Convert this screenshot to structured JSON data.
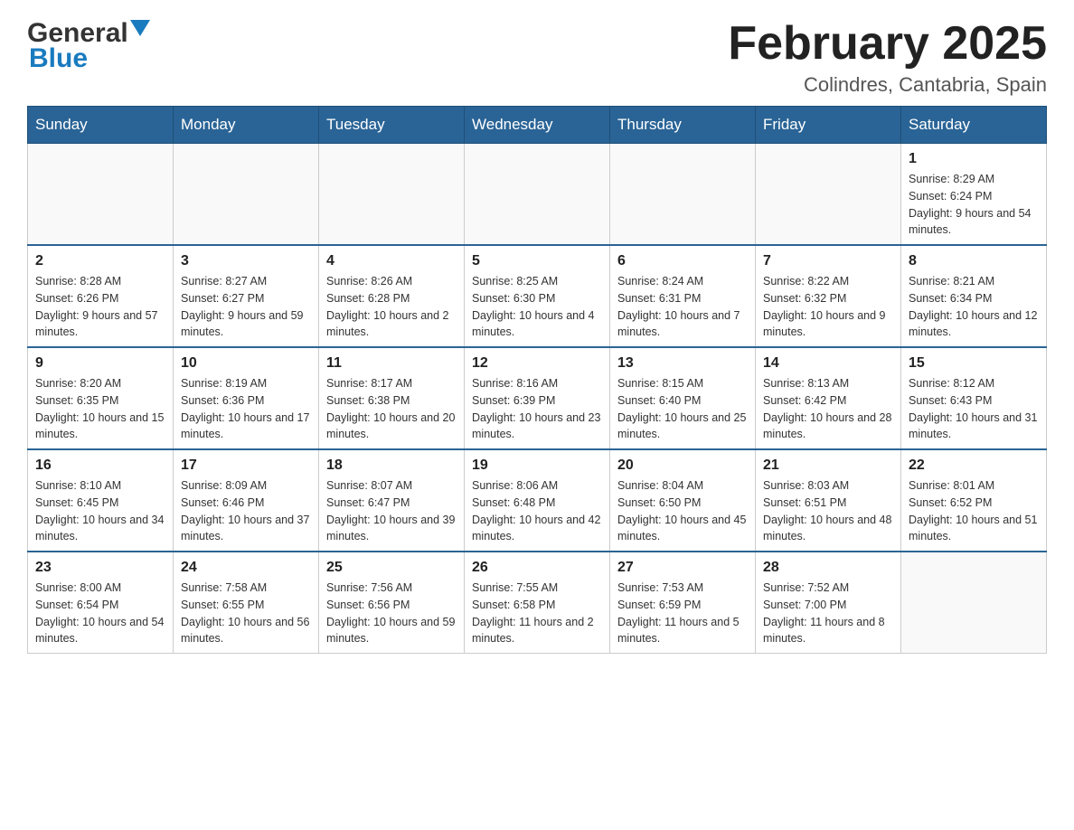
{
  "header": {
    "logo_general": "General",
    "logo_blue": "Blue",
    "title": "February 2025",
    "location": "Colindres, Cantabria, Spain"
  },
  "weekdays": [
    "Sunday",
    "Monday",
    "Tuesday",
    "Wednesday",
    "Thursday",
    "Friday",
    "Saturday"
  ],
  "weeks": [
    [
      {
        "day": "",
        "info": ""
      },
      {
        "day": "",
        "info": ""
      },
      {
        "day": "",
        "info": ""
      },
      {
        "day": "",
        "info": ""
      },
      {
        "day": "",
        "info": ""
      },
      {
        "day": "",
        "info": ""
      },
      {
        "day": "1",
        "info": "Sunrise: 8:29 AM\nSunset: 6:24 PM\nDaylight: 9 hours and 54 minutes."
      }
    ],
    [
      {
        "day": "2",
        "info": "Sunrise: 8:28 AM\nSunset: 6:26 PM\nDaylight: 9 hours and 57 minutes."
      },
      {
        "day": "3",
        "info": "Sunrise: 8:27 AM\nSunset: 6:27 PM\nDaylight: 9 hours and 59 minutes."
      },
      {
        "day": "4",
        "info": "Sunrise: 8:26 AM\nSunset: 6:28 PM\nDaylight: 10 hours and 2 minutes."
      },
      {
        "day": "5",
        "info": "Sunrise: 8:25 AM\nSunset: 6:30 PM\nDaylight: 10 hours and 4 minutes."
      },
      {
        "day": "6",
        "info": "Sunrise: 8:24 AM\nSunset: 6:31 PM\nDaylight: 10 hours and 7 minutes."
      },
      {
        "day": "7",
        "info": "Sunrise: 8:22 AM\nSunset: 6:32 PM\nDaylight: 10 hours and 9 minutes."
      },
      {
        "day": "8",
        "info": "Sunrise: 8:21 AM\nSunset: 6:34 PM\nDaylight: 10 hours and 12 minutes."
      }
    ],
    [
      {
        "day": "9",
        "info": "Sunrise: 8:20 AM\nSunset: 6:35 PM\nDaylight: 10 hours and 15 minutes."
      },
      {
        "day": "10",
        "info": "Sunrise: 8:19 AM\nSunset: 6:36 PM\nDaylight: 10 hours and 17 minutes."
      },
      {
        "day": "11",
        "info": "Sunrise: 8:17 AM\nSunset: 6:38 PM\nDaylight: 10 hours and 20 minutes."
      },
      {
        "day": "12",
        "info": "Sunrise: 8:16 AM\nSunset: 6:39 PM\nDaylight: 10 hours and 23 minutes."
      },
      {
        "day": "13",
        "info": "Sunrise: 8:15 AM\nSunset: 6:40 PM\nDaylight: 10 hours and 25 minutes."
      },
      {
        "day": "14",
        "info": "Sunrise: 8:13 AM\nSunset: 6:42 PM\nDaylight: 10 hours and 28 minutes."
      },
      {
        "day": "15",
        "info": "Sunrise: 8:12 AM\nSunset: 6:43 PM\nDaylight: 10 hours and 31 minutes."
      }
    ],
    [
      {
        "day": "16",
        "info": "Sunrise: 8:10 AM\nSunset: 6:45 PM\nDaylight: 10 hours and 34 minutes."
      },
      {
        "day": "17",
        "info": "Sunrise: 8:09 AM\nSunset: 6:46 PM\nDaylight: 10 hours and 37 minutes."
      },
      {
        "day": "18",
        "info": "Sunrise: 8:07 AM\nSunset: 6:47 PM\nDaylight: 10 hours and 39 minutes."
      },
      {
        "day": "19",
        "info": "Sunrise: 8:06 AM\nSunset: 6:48 PM\nDaylight: 10 hours and 42 minutes."
      },
      {
        "day": "20",
        "info": "Sunrise: 8:04 AM\nSunset: 6:50 PM\nDaylight: 10 hours and 45 minutes."
      },
      {
        "day": "21",
        "info": "Sunrise: 8:03 AM\nSunset: 6:51 PM\nDaylight: 10 hours and 48 minutes."
      },
      {
        "day": "22",
        "info": "Sunrise: 8:01 AM\nSunset: 6:52 PM\nDaylight: 10 hours and 51 minutes."
      }
    ],
    [
      {
        "day": "23",
        "info": "Sunrise: 8:00 AM\nSunset: 6:54 PM\nDaylight: 10 hours and 54 minutes."
      },
      {
        "day": "24",
        "info": "Sunrise: 7:58 AM\nSunset: 6:55 PM\nDaylight: 10 hours and 56 minutes."
      },
      {
        "day": "25",
        "info": "Sunrise: 7:56 AM\nSunset: 6:56 PM\nDaylight: 10 hours and 59 minutes."
      },
      {
        "day": "26",
        "info": "Sunrise: 7:55 AM\nSunset: 6:58 PM\nDaylight: 11 hours and 2 minutes."
      },
      {
        "day": "27",
        "info": "Sunrise: 7:53 AM\nSunset: 6:59 PM\nDaylight: 11 hours and 5 minutes."
      },
      {
        "day": "28",
        "info": "Sunrise: 7:52 AM\nSunset: 7:00 PM\nDaylight: 11 hours and 8 minutes."
      },
      {
        "day": "",
        "info": ""
      }
    ]
  ]
}
